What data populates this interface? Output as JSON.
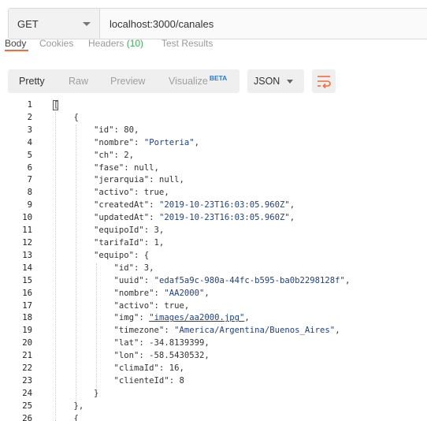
{
  "request": {
    "method": "GET",
    "url": "localhost:3000/canales"
  },
  "response_tabs": [
    {
      "label": "Body"
    },
    {
      "label": "Cookies"
    },
    {
      "label": "Headers",
      "count": "(10)"
    },
    {
      "label": "Test Results"
    }
  ],
  "toolbar": {
    "pretty": "Pretty",
    "raw": "Raw",
    "preview": "Preview",
    "visualize": "Visualize",
    "beta": "BETA",
    "format": "JSON"
  },
  "colors": {
    "accent": "#f26b3a",
    "string": "#1f3f8f",
    "beta": "#2a78d6",
    "count": "#3fae5a"
  },
  "icons": {
    "format_caret": "chevron-down-icon",
    "method_caret": "chevron-down-icon",
    "wrap": "wrap-lines-icon"
  },
  "code_lines": [
    {
      "n": "1",
      "t": "["
    },
    {
      "n": "2",
      "t": "    {"
    },
    {
      "n": "3",
      "t": "        \"id\": 80,"
    },
    {
      "n": "4",
      "t": "        \"nombre\": \"Porteria\","
    },
    {
      "n": "5",
      "t": "        \"ch\": 2,"
    },
    {
      "n": "6",
      "t": "        \"fase\": null,"
    },
    {
      "n": "7",
      "t": "        \"jerarquia\": null,"
    },
    {
      "n": "8",
      "t": "        \"activo\": true,"
    },
    {
      "n": "9",
      "t": "        \"createdAt\": \"2019-10-23T16:03:05.960Z\","
    },
    {
      "n": "10",
      "t": "        \"updatedAt\": \"2019-10-23T16:03:05.960Z\","
    },
    {
      "n": "11",
      "t": "        \"equipoId\": 3,"
    },
    {
      "n": "12",
      "t": "        \"tarifaId\": 1,"
    },
    {
      "n": "13",
      "t": "        \"equipo\": {"
    },
    {
      "n": "14",
      "t": "            \"id\": 3,"
    },
    {
      "n": "15",
      "t": "            \"uuid\": \"edaf5a9c-980a-44fc-b595-ba0b2298128f\","
    },
    {
      "n": "16",
      "t": "            \"nombre\": \"AA2000\","
    },
    {
      "n": "17",
      "t": "            \"activo\": true,"
    },
    {
      "n": "18",
      "t": "            \"img\": \"images/aa2000.jpg\","
    },
    {
      "n": "19",
      "t": "            \"timezone\": \"America/Argentina/Buenos_Aires\","
    },
    {
      "n": "20",
      "t": "            \"lat\": -34.8139399,"
    },
    {
      "n": "21",
      "t": "            \"lon\": -58.5430532,"
    },
    {
      "n": "22",
      "t": "            \"climaId\": 16,"
    },
    {
      "n": "23",
      "t": "            \"clienteId\": 8"
    },
    {
      "n": "24",
      "t": "        }"
    },
    {
      "n": "25",
      "t": "    },"
    },
    {
      "n": "26",
      "t": "    {"
    }
  ]
}
